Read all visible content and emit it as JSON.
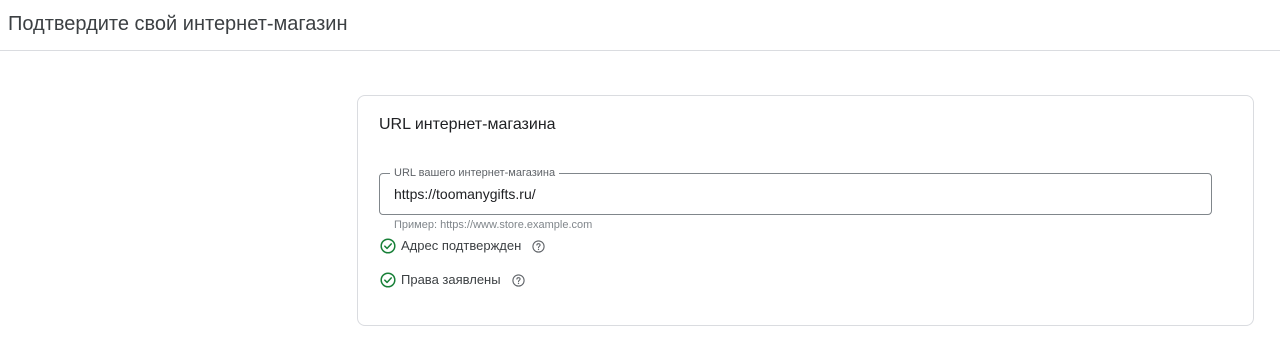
{
  "header": {
    "title": "Подтвердите свой интернет-магазин"
  },
  "card": {
    "title": "URL интернет-магазина",
    "url_field": {
      "label": "URL вашего интернет-магазина",
      "value": "https://toomanygifts.ru/"
    },
    "helper_text": "Пример: https://www.store.example.com",
    "statuses": [
      {
        "label": "Адрес подтвержден",
        "icon": "check-circle-icon",
        "help_icon": "help-circle-icon"
      },
      {
        "label": "Права заявлены",
        "icon": "check-circle-icon",
        "help_icon": "help-circle-icon"
      }
    ]
  },
  "colors": {
    "success": "#188038",
    "border": "#dadce0",
    "text": "#202124",
    "secondary_text": "#5f6368"
  }
}
